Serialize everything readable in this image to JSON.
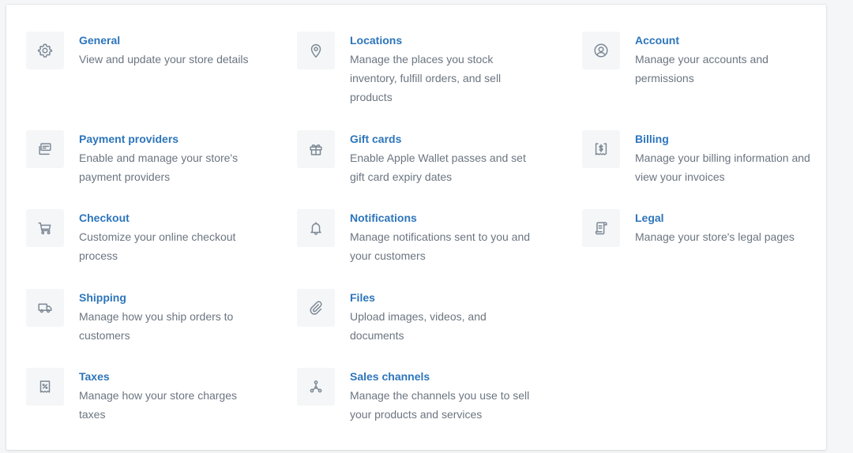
{
  "colors": {
    "link": "#2d75bb",
    "description": "#6b7580",
    "icon": "#7c8894",
    "icon_bg": "#f4f6f8"
  },
  "settings": [
    {
      "key": "general",
      "icon": "gear-icon",
      "title": "General",
      "description": "View and update your store details"
    },
    {
      "key": "locations",
      "icon": "location-pin-icon",
      "title": "Locations",
      "description": "Manage the places you stock inventory, fulfill orders, and sell products"
    },
    {
      "key": "account",
      "icon": "account-user-icon",
      "title": "Account",
      "description": "Manage your accounts and permissions"
    },
    {
      "key": "payment_providers",
      "icon": "credit-card-icon",
      "title": "Payment providers",
      "description": "Enable and manage your store's payment providers"
    },
    {
      "key": "gift_cards",
      "icon": "gift-icon",
      "title": "Gift cards",
      "description": "Enable Apple Wallet passes and set gift card expiry dates"
    },
    {
      "key": "billing",
      "icon": "billing-receipt-icon",
      "title": "Billing",
      "description": "Manage your billing information and view your invoices"
    },
    {
      "key": "checkout",
      "icon": "cart-icon",
      "title": "Checkout",
      "description": "Customize your online checkout process"
    },
    {
      "key": "notifications",
      "icon": "bell-icon",
      "title": "Notifications",
      "description": "Manage notifications sent to you and your customers"
    },
    {
      "key": "legal",
      "icon": "legal-document-icon",
      "title": "Legal",
      "description": "Manage your store's legal pages"
    },
    {
      "key": "shipping",
      "icon": "truck-icon",
      "title": "Shipping",
      "description": "Manage how you ship orders to customers"
    },
    {
      "key": "files",
      "icon": "paperclip-icon",
      "title": "Files",
      "description": "Upload images, videos, and documents"
    },
    {
      "key": "taxes",
      "icon": "tax-receipt-icon",
      "title": "Taxes",
      "description": "Manage how your store charges taxes"
    },
    {
      "key": "sales_channels",
      "icon": "sales-channels-icon",
      "title": "Sales channels",
      "description": "Manage the channels you use to sell your products and services"
    }
  ]
}
